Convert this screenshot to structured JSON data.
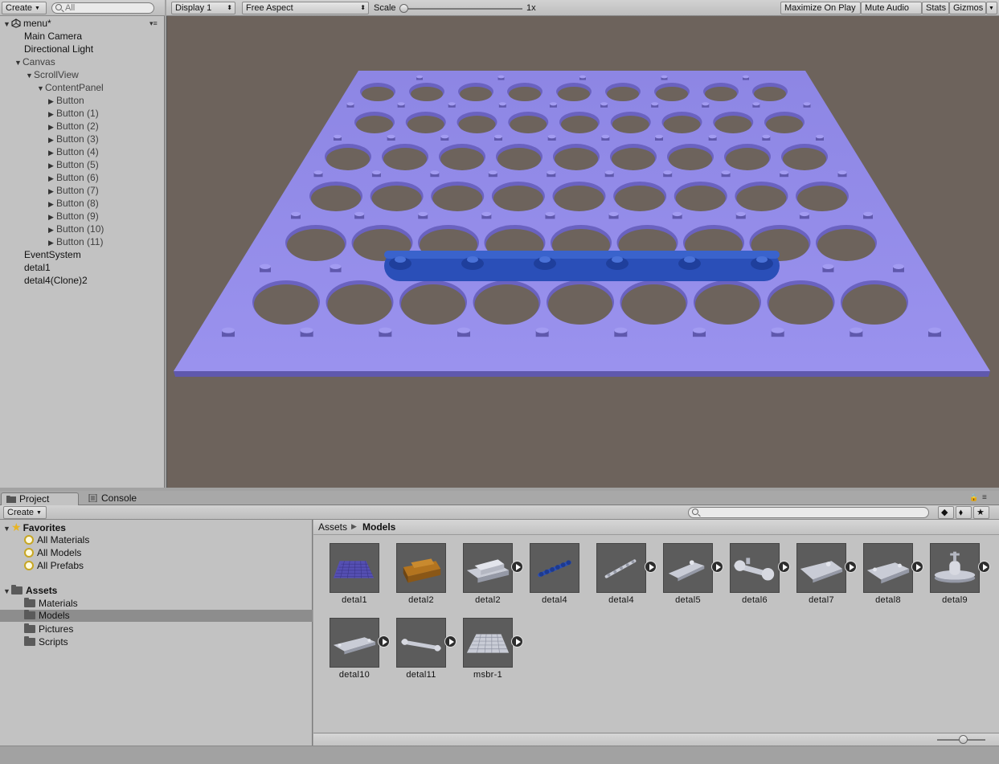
{
  "hierarchy": {
    "create_label": "Create",
    "search_placeholder": "All",
    "scene_name": "menu*",
    "items": [
      {
        "label": "Main Camera"
      },
      {
        "label": "Directional Light"
      },
      {
        "label": "Canvas"
      },
      {
        "label": "ScrollView"
      },
      {
        "label": "ContentPanel"
      },
      {
        "label": "Button"
      },
      {
        "label": "Button (1)"
      },
      {
        "label": "Button (2)"
      },
      {
        "label": "Button (3)"
      },
      {
        "label": "Button (4)"
      },
      {
        "label": "Button (5)"
      },
      {
        "label": "Button (6)"
      },
      {
        "label": "Button (7)"
      },
      {
        "label": "Button (8)"
      },
      {
        "label": "Button (9)"
      },
      {
        "label": "Button (10)"
      },
      {
        "label": "Button (11)"
      },
      {
        "label": "EventSystem"
      },
      {
        "label": "detal1"
      },
      {
        "label": "detal4(Clone)2"
      }
    ]
  },
  "game": {
    "display": "Display 1",
    "aspect": "Free Aspect",
    "scale_label": "Scale",
    "scale_value": "1x",
    "maximize_on_play": "Maximize On Play",
    "mute_audio": "Mute Audio",
    "stats": "Stats",
    "gizmos": "Gizmos"
  },
  "project": {
    "tabs": [
      {
        "label": "Project"
      },
      {
        "label": "Console"
      }
    ],
    "create_label": "Create",
    "favorites": {
      "label": "Favorites",
      "items": [
        {
          "label": "All Materials"
        },
        {
          "label": "All Models"
        },
        {
          "label": "All Prefabs"
        }
      ]
    },
    "assets": {
      "label": "Assets",
      "folders": [
        {
          "label": "Materials"
        },
        {
          "label": "Models"
        },
        {
          "label": "Pictures"
        },
        {
          "label": "Scripts"
        }
      ]
    },
    "breadcrumb": {
      "root": "Assets",
      "current": "Models"
    },
    "grid": [
      {
        "label": "detal1"
      },
      {
        "label": "detal2"
      },
      {
        "label": "detal2"
      },
      {
        "label": "detal4"
      },
      {
        "label": "detal4"
      },
      {
        "label": "detal5"
      },
      {
        "label": "detal6"
      },
      {
        "label": "detal7"
      },
      {
        "label": "detal8"
      },
      {
        "label": "detal9"
      },
      {
        "label": "detal10"
      },
      {
        "label": "detal11"
      },
      {
        "label": "msbr-1"
      }
    ]
  },
  "colors": {
    "plate": "#8f87e6",
    "plate_dark": "#6a62c0",
    "bar": "#2a4fb8",
    "game_bg": "#6d635c"
  }
}
